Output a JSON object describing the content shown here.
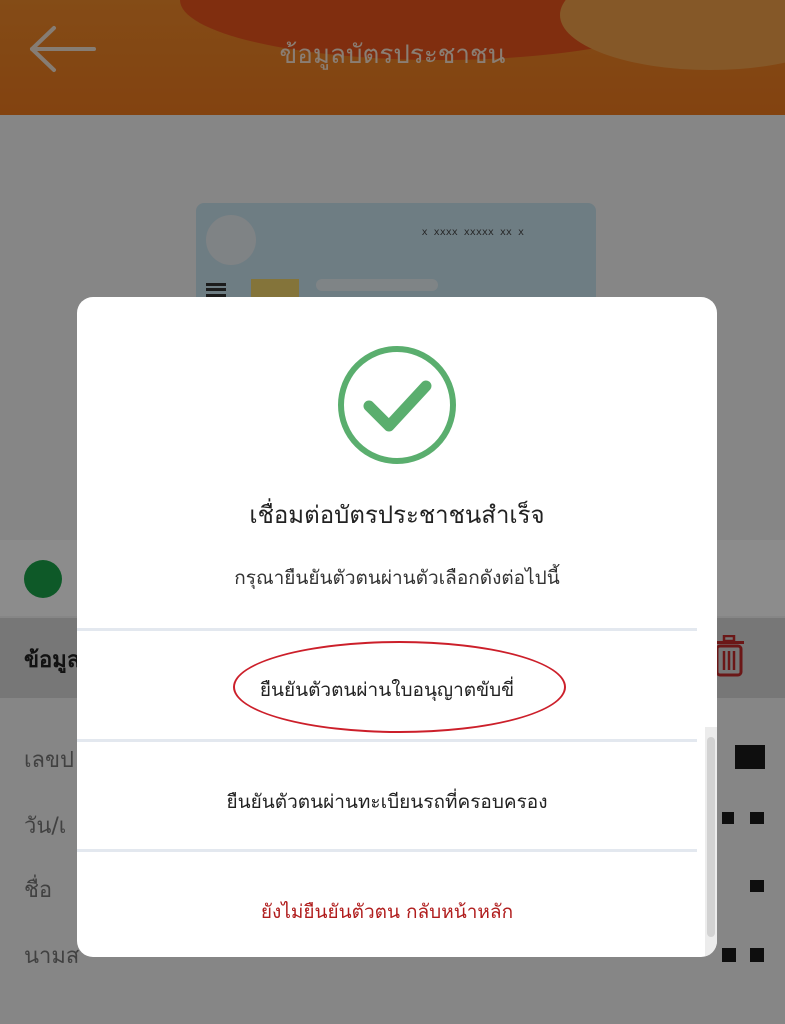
{
  "header": {
    "title": "ข้อมูลบัตรประชาชน",
    "back_icon": "arrow-left-icon"
  },
  "id_card": {
    "number_mask": "x xxxx xxxxx xx x"
  },
  "section": {
    "title": "ข้อมูล",
    "delete_icon": "trash-icon"
  },
  "info": {
    "rows": [
      "เลขป",
      "วัน/เ",
      "ชื่อ",
      "นามส"
    ]
  },
  "dialog": {
    "success_icon": "check-circle-icon",
    "title": "เชื่อมต่อบัตรประชาชนสำเร็จ",
    "subtitle": "กรุณายืนยันตัวตนผ่านตัวเลือกดังต่อไปนี้",
    "options": [
      "ยืนยันตัวตนผ่านใบอนุญาตขับขี่",
      "ยืนยันตัวตนผ่านทะเบียนรถที่ครอบครอง"
    ],
    "cancel_label": "ยังไม่ยืนยันตัวตน กลับหน้าหลัก"
  },
  "colors": {
    "header": "#ee7a1e",
    "success_green": "#5aae6e",
    "status_green": "#1aa34a",
    "danger": "#b01d1d",
    "annotation_red": "#cc1f2a"
  }
}
